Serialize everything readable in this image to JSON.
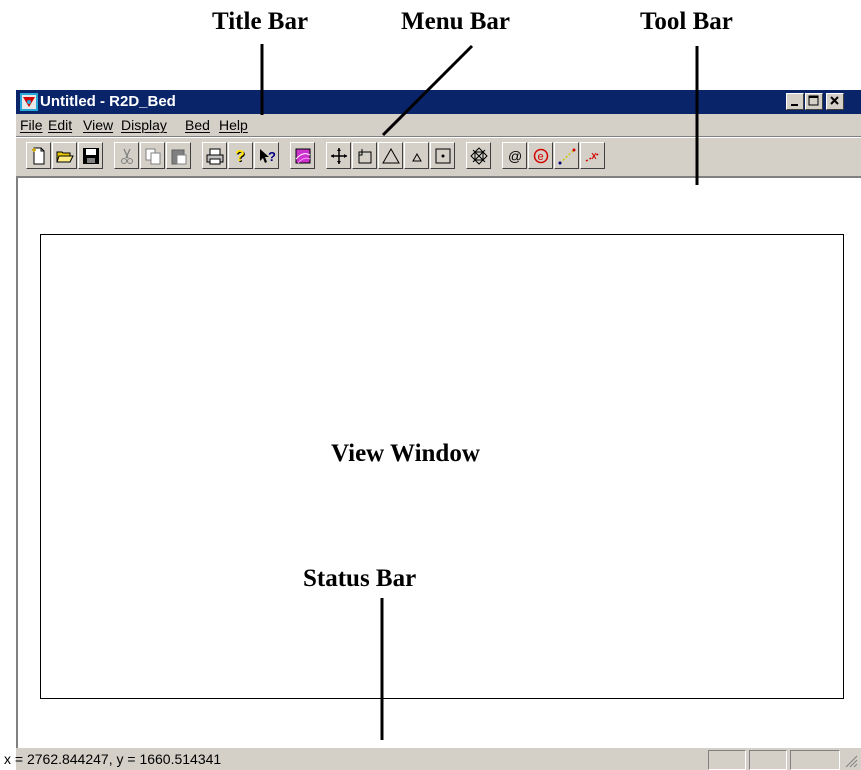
{
  "callouts": {
    "title_bar": "Title Bar",
    "menu_bar": "Menu Bar",
    "tool_bar": "Tool Bar",
    "view_window": "View Window",
    "status_bar": "Status Bar"
  },
  "window": {
    "title": "Untitled - R2D_Bed",
    "app_icon": "app-icon",
    "controls": [
      "minimize-icon",
      "maximize-icon",
      "close-icon"
    ]
  },
  "menu": {
    "items": [
      "File",
      "Edit",
      "View",
      "Display",
      "Bed",
      "Help"
    ]
  },
  "toolbar": {
    "buttons": [
      "new-icon",
      "open-icon",
      "save-icon",
      "cut-icon",
      "copy-icon",
      "paste-icon",
      "print-icon",
      "help-icon",
      "context-help-icon",
      "color-map-icon",
      "pan-icon",
      "select-area-icon",
      "triangle-icon",
      "small-triangle-icon",
      "point-icon",
      "delete-node-icon",
      "at-sign-icon",
      "element-icon",
      "line-icon",
      "cross-line-icon"
    ]
  },
  "status": {
    "coordinates": "x = 2762.844247, y = 1660.514341"
  },
  "colors": {
    "title_bar": "#0a246a",
    "chrome": "#d4d0c8",
    "accent_red": "#d40000",
    "accent_magenta": "#cc33cc"
  }
}
